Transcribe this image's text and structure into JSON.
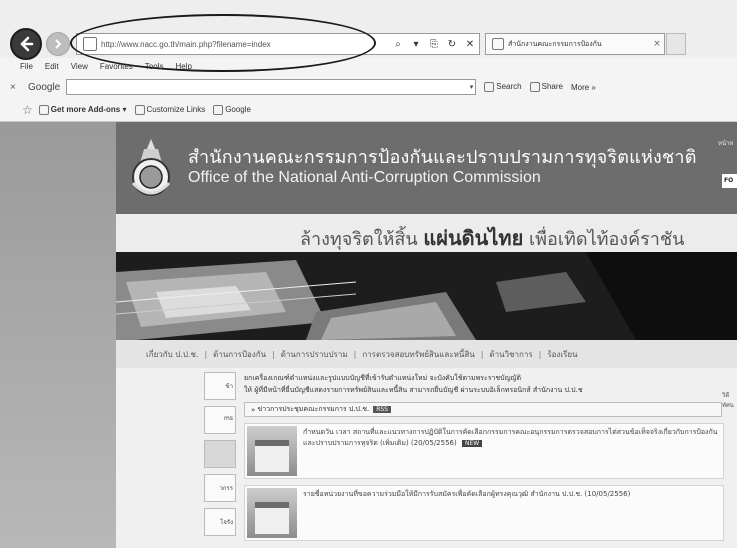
{
  "browser": {
    "url": "http://www.nacc.go.th/main.php?filename=index",
    "tab_title": "สำนักงานคณะกรรมการป้องกัน",
    "tab_close": "×",
    "search_glyph": "⌕",
    "dropdown_glyph": "▾",
    "compat_glyph": "⎘",
    "refresh_glyph": "↻",
    "stop_glyph": "✕",
    "menu": [
      "File",
      "Edit",
      "View",
      "Favorites",
      "Tools",
      "Help"
    ],
    "google_toolbar": {
      "close": "×",
      "logo": "Google",
      "search_label": "Search",
      "share_label": "Share",
      "more_label": "More »"
    },
    "favorites_bar": {
      "add_ons_label": "Get more Add-ons",
      "customize_label": "Customize Links",
      "google_label": "Google"
    }
  },
  "site": {
    "org_name_thai": "สำนักงานคณะกรรมการป้องกันและปราบปรามการทุจริตแห่งชาติ",
    "org_name_en": "Office of the National Anti-Corruption Commission",
    "right_snippet": "หน้าห",
    "right_badge": "FO",
    "slogan_part1": "ล้างทุจริตให้สิ้น",
    "slogan_bold": "แผ่นดินไทย",
    "slogan_part2": "เพื่อเทิดไท้องค์ราชัน",
    "nav_links": [
      "เกี่ยวกับ ป.ป.ช.",
      "ด้านการป้องกัน",
      "ด้านการปราบปราม",
      "การตรวจสอบทรัพย์สินและหนี้สิน",
      "ด้านวิชาการ",
      "ร้องเรียน"
    ],
    "side_boxes": [
      "ข้า",
      "ms",
      "",
      "วกรร",
      "โจรัง"
    ],
    "announcement_line1": "ยกเครื่องเกณฑ์ตำแหน่งและรูปแบบบัญชีที่เข้ารับตำแหน่งใหม่ จะบังคับใช้ตามพระราชบัญญัติ",
    "announcement_line2": "ให้ ผู้ที่มีหน้าที่ยื่นบัญชีแสดงรายการทรัพย์สินและหนี้สิน สามารถยื่นบัญชี ผ่านระบบอิเล็กทรอนิกส์ สำนักงาน ป.ป.ช",
    "section_header": "ข่าวการประชุมคณะกรรมการ ป.ป.ช.",
    "section_tag": "RSS",
    "right_clip": "วิดีทัศน",
    "news": [
      {
        "text": "กำหนดวัน เวลา สถานที่และแนวทางการปฏิบัติในการคัดเลือกกรรมการคณะอนุกรรมการตรวจสอบการไต่สวนข้อเท็จจริงเกี่ยวกับการป้องกันและปราบปรามการทุจริต (เพิ่มเติม) (20/05/2556)",
        "tag": "NEW"
      },
      {
        "text": "รายชื่อหน่วยงานที่ขอความร่วมมือให้มีการรับสมัครเพื่อคัดเลือกผู้ทรงคุณวุฒิ สำนักงาน ป.ป.ช. (10/05/2556)",
        "tag": ""
      }
    ]
  }
}
